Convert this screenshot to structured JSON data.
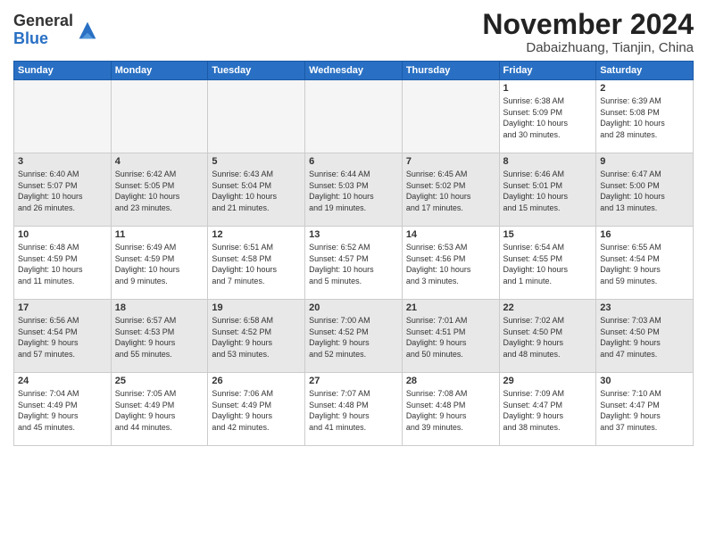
{
  "logo": {
    "general": "General",
    "blue": "Blue"
  },
  "header": {
    "month": "November 2024",
    "location": "Dabaizhuang, Tianjin, China"
  },
  "weekdays": [
    "Sunday",
    "Monday",
    "Tuesday",
    "Wednesday",
    "Thursday",
    "Friday",
    "Saturday"
  ],
  "weeks": [
    [
      {
        "day": "",
        "info": ""
      },
      {
        "day": "",
        "info": ""
      },
      {
        "day": "",
        "info": ""
      },
      {
        "day": "",
        "info": ""
      },
      {
        "day": "",
        "info": ""
      },
      {
        "day": "1",
        "info": "Sunrise: 6:38 AM\nSunset: 5:09 PM\nDaylight: 10 hours\nand 30 minutes."
      },
      {
        "day": "2",
        "info": "Sunrise: 6:39 AM\nSunset: 5:08 PM\nDaylight: 10 hours\nand 28 minutes."
      }
    ],
    [
      {
        "day": "3",
        "info": "Sunrise: 6:40 AM\nSunset: 5:07 PM\nDaylight: 10 hours\nand 26 minutes."
      },
      {
        "day": "4",
        "info": "Sunrise: 6:42 AM\nSunset: 5:05 PM\nDaylight: 10 hours\nand 23 minutes."
      },
      {
        "day": "5",
        "info": "Sunrise: 6:43 AM\nSunset: 5:04 PM\nDaylight: 10 hours\nand 21 minutes."
      },
      {
        "day": "6",
        "info": "Sunrise: 6:44 AM\nSunset: 5:03 PM\nDaylight: 10 hours\nand 19 minutes."
      },
      {
        "day": "7",
        "info": "Sunrise: 6:45 AM\nSunset: 5:02 PM\nDaylight: 10 hours\nand 17 minutes."
      },
      {
        "day": "8",
        "info": "Sunrise: 6:46 AM\nSunset: 5:01 PM\nDaylight: 10 hours\nand 15 minutes."
      },
      {
        "day": "9",
        "info": "Sunrise: 6:47 AM\nSunset: 5:00 PM\nDaylight: 10 hours\nand 13 minutes."
      }
    ],
    [
      {
        "day": "10",
        "info": "Sunrise: 6:48 AM\nSunset: 4:59 PM\nDaylight: 10 hours\nand 11 minutes."
      },
      {
        "day": "11",
        "info": "Sunrise: 6:49 AM\nSunset: 4:59 PM\nDaylight: 10 hours\nand 9 minutes."
      },
      {
        "day": "12",
        "info": "Sunrise: 6:51 AM\nSunset: 4:58 PM\nDaylight: 10 hours\nand 7 minutes."
      },
      {
        "day": "13",
        "info": "Sunrise: 6:52 AM\nSunset: 4:57 PM\nDaylight: 10 hours\nand 5 minutes."
      },
      {
        "day": "14",
        "info": "Sunrise: 6:53 AM\nSunset: 4:56 PM\nDaylight: 10 hours\nand 3 minutes."
      },
      {
        "day": "15",
        "info": "Sunrise: 6:54 AM\nSunset: 4:55 PM\nDaylight: 10 hours\nand 1 minute."
      },
      {
        "day": "16",
        "info": "Sunrise: 6:55 AM\nSunset: 4:54 PM\nDaylight: 9 hours\nand 59 minutes."
      }
    ],
    [
      {
        "day": "17",
        "info": "Sunrise: 6:56 AM\nSunset: 4:54 PM\nDaylight: 9 hours\nand 57 minutes."
      },
      {
        "day": "18",
        "info": "Sunrise: 6:57 AM\nSunset: 4:53 PM\nDaylight: 9 hours\nand 55 minutes."
      },
      {
        "day": "19",
        "info": "Sunrise: 6:58 AM\nSunset: 4:52 PM\nDaylight: 9 hours\nand 53 minutes."
      },
      {
        "day": "20",
        "info": "Sunrise: 7:00 AM\nSunset: 4:52 PM\nDaylight: 9 hours\nand 52 minutes."
      },
      {
        "day": "21",
        "info": "Sunrise: 7:01 AM\nSunset: 4:51 PM\nDaylight: 9 hours\nand 50 minutes."
      },
      {
        "day": "22",
        "info": "Sunrise: 7:02 AM\nSunset: 4:50 PM\nDaylight: 9 hours\nand 48 minutes."
      },
      {
        "day": "23",
        "info": "Sunrise: 7:03 AM\nSunset: 4:50 PM\nDaylight: 9 hours\nand 47 minutes."
      }
    ],
    [
      {
        "day": "24",
        "info": "Sunrise: 7:04 AM\nSunset: 4:49 PM\nDaylight: 9 hours\nand 45 minutes."
      },
      {
        "day": "25",
        "info": "Sunrise: 7:05 AM\nSunset: 4:49 PM\nDaylight: 9 hours\nand 44 minutes."
      },
      {
        "day": "26",
        "info": "Sunrise: 7:06 AM\nSunset: 4:49 PM\nDaylight: 9 hours\nand 42 minutes."
      },
      {
        "day": "27",
        "info": "Sunrise: 7:07 AM\nSunset: 4:48 PM\nDaylight: 9 hours\nand 41 minutes."
      },
      {
        "day": "28",
        "info": "Sunrise: 7:08 AM\nSunset: 4:48 PM\nDaylight: 9 hours\nand 39 minutes."
      },
      {
        "day": "29",
        "info": "Sunrise: 7:09 AM\nSunset: 4:47 PM\nDaylight: 9 hours\nand 38 minutes."
      },
      {
        "day": "30",
        "info": "Sunrise: 7:10 AM\nSunset: 4:47 PM\nDaylight: 9 hours\nand 37 minutes."
      }
    ]
  ]
}
